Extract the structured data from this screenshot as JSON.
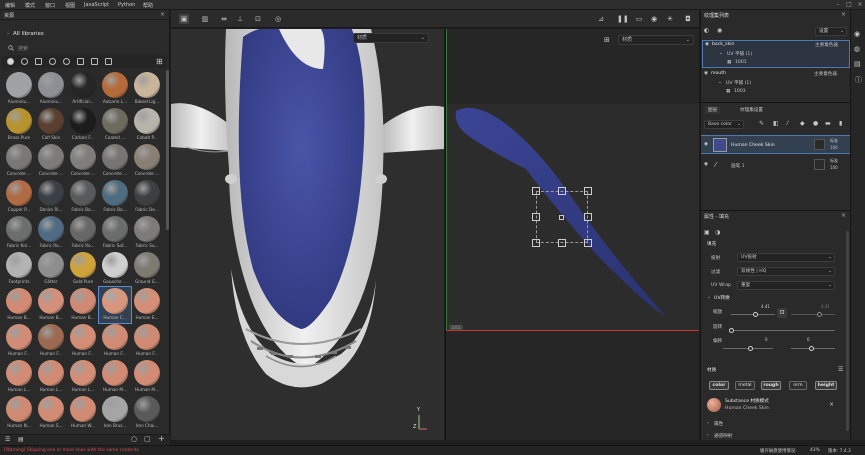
{
  "menu": [
    "编辑",
    "模式",
    "窗口",
    "视图",
    "JavaScript",
    "Python",
    "帮助"
  ],
  "library": {
    "title": "资源",
    "section": "All libraries",
    "search_placeholder": "搜索",
    "materials": [
      {
        "label": "Aluminiu...",
        "color": "#9fa3a6"
      },
      {
        "label": "Aluminiu...",
        "color": "#8c9095"
      },
      {
        "label": "Artificial...",
        "color": "#262626"
      },
      {
        "label": "Autumn L...",
        "color": "#b56a3a"
      },
      {
        "label": "Baked Lig...",
        "color": "#c9b59a"
      },
      {
        "label": "Brass Pure",
        "color": "#b8922e"
      },
      {
        "label": "Calf Skin",
        "color": "#5a4030"
      },
      {
        "label": "Carbon F...",
        "color": "#1c1c1c"
      },
      {
        "label": "Coated ...",
        "color": "#6d6a5e"
      },
      {
        "label": "Cobalt P...",
        "color": "#b7b4ab"
      },
      {
        "label": "Concrete ...",
        "color": "#7a7875"
      },
      {
        "label": "Concrete ...",
        "color": "#7d7b78"
      },
      {
        "label": "Concrete ...",
        "color": "#807e7a"
      },
      {
        "label": "Concrete ...",
        "color": "#767571"
      },
      {
        "label": "Concrete ...",
        "color": "#8a7f74"
      },
      {
        "label": "Copper P...",
        "color": "#b06a44"
      },
      {
        "label": "Denim Ri...",
        "color": "#3b3f46"
      },
      {
        "label": "Fabric Ba...",
        "color": "#585b5c"
      },
      {
        "label": "Fabric Ba...",
        "color": "#4f6b80"
      },
      {
        "label": "Fabric De...",
        "color": "#3e3f41"
      },
      {
        "label": "Fabric Kni...",
        "color": "#6c6d6d"
      },
      {
        "label": "Fabric Ro...",
        "color": "#4f6a82"
      },
      {
        "label": "Fabric Ro...",
        "color": "#676767"
      },
      {
        "label": "Fabric Sof...",
        "color": "#6b6c6c"
      },
      {
        "label": "Fabric Su...",
        "color": "#7c7b79"
      },
      {
        "label": "Footprints",
        "color": "#b3b3b3"
      },
      {
        "label": "Glitter",
        "color": "#8e8e8e"
      },
      {
        "label": "Gold Pure",
        "color": "#cfa33a"
      },
      {
        "label": "Gouache ...",
        "color": "#cfcfcf"
      },
      {
        "label": "Ground G...",
        "color": "#7d7a72"
      },
      {
        "label": "Human B...",
        "color": "#d28a72"
      },
      {
        "label": "Human B...",
        "color": "#d4907a"
      },
      {
        "label": "Human B...",
        "color": "#d08a74"
      },
      {
        "label": "Human C...",
        "color": "#d8977d"
      },
      {
        "label": "Human E...",
        "color": "#d58f77"
      },
      {
        "label": "Human F...",
        "color": "#d28c76"
      },
      {
        "label": "Human F...",
        "color": "#9b6a50"
      },
      {
        "label": "Human F...",
        "color": "#d38d75"
      },
      {
        "label": "Human F...",
        "color": "#d28b73"
      },
      {
        "label": "Human F...",
        "color": "#d18a72"
      },
      {
        "label": "Human L...",
        "color": "#d38c74"
      },
      {
        "label": "Human L...",
        "color": "#d28b73"
      },
      {
        "label": "Human L...",
        "color": "#d48e76"
      },
      {
        "label": "Human M...",
        "color": "#d28b73"
      },
      {
        "label": "Human M...",
        "color": "#d38c74"
      },
      {
        "label": "Human N...",
        "color": "#d18a72"
      },
      {
        "label": "Human S...",
        "color": "#d38c74"
      },
      {
        "label": "Human W...",
        "color": "#d28b73"
      },
      {
        "label": "Iron Brus...",
        "color": "#a5a5a5"
      },
      {
        "label": "Iron Chai...",
        "color": "#5a5a5a"
      }
    ],
    "selected_index": 33
  },
  "viewport3d": {
    "mode": "材质"
  },
  "viewport2d": {
    "mode": "材质",
    "uv_tile": "1001"
  },
  "texture_sets": {
    "title": "纹理集列表",
    "dropdown": "设置",
    "sets": [
      {
        "name": "back_skin",
        "shader": "主要着色器",
        "uv_label": "UV 平铺 (1)",
        "tile": "1001"
      },
      {
        "name": "mouth",
        "shader": "主要着色器",
        "uv_label": "UV 平铺 (1)",
        "tile": "1003"
      }
    ]
  },
  "layers": {
    "tabs": [
      "图层",
      "纹理集设置"
    ],
    "channel": "Base color",
    "items": [
      {
        "name": "Human Cheek Skin",
        "blend": "标准",
        "opacity": "100"
      },
      {
        "name": "画笔 1",
        "blend": "标准",
        "opacity": "100"
      }
    ]
  },
  "properties": {
    "title": "属性 - 填充",
    "section_fill": "填充",
    "projection_label": "投射",
    "projection_value": "UV投射",
    "filter_label": "过滤",
    "filter_value": "双线性 | HQ",
    "uvwrap_label": "UV Wrap",
    "uvwrap_value": "重复",
    "uv_transform": "UV转换",
    "scale_label": "缩放",
    "scale_value": "4.41",
    "scale_value2": "4.41",
    "rotation_label": "旋转",
    "offset_label": "偏移",
    "offset_value": "0",
    "offset_value2": "0",
    "material_section": "材质",
    "channels": [
      "color",
      "metal",
      "rough",
      "nrm",
      "height"
    ],
    "substance_name": "Substance 材质模式",
    "substance_sub": "Human Cheek Skin",
    "collapsed_1": "属性",
    "collapsed_2": "通道映射"
  },
  "status": {
    "error": "[Warning] Skipping one or more lines with the same contents",
    "cache": "缓存磁盘使用情况:",
    "cache_pct": "43%",
    "version": "版本: 7.4.3"
  },
  "axes": {
    "x": "X",
    "y": "Y",
    "z": "Z"
  }
}
